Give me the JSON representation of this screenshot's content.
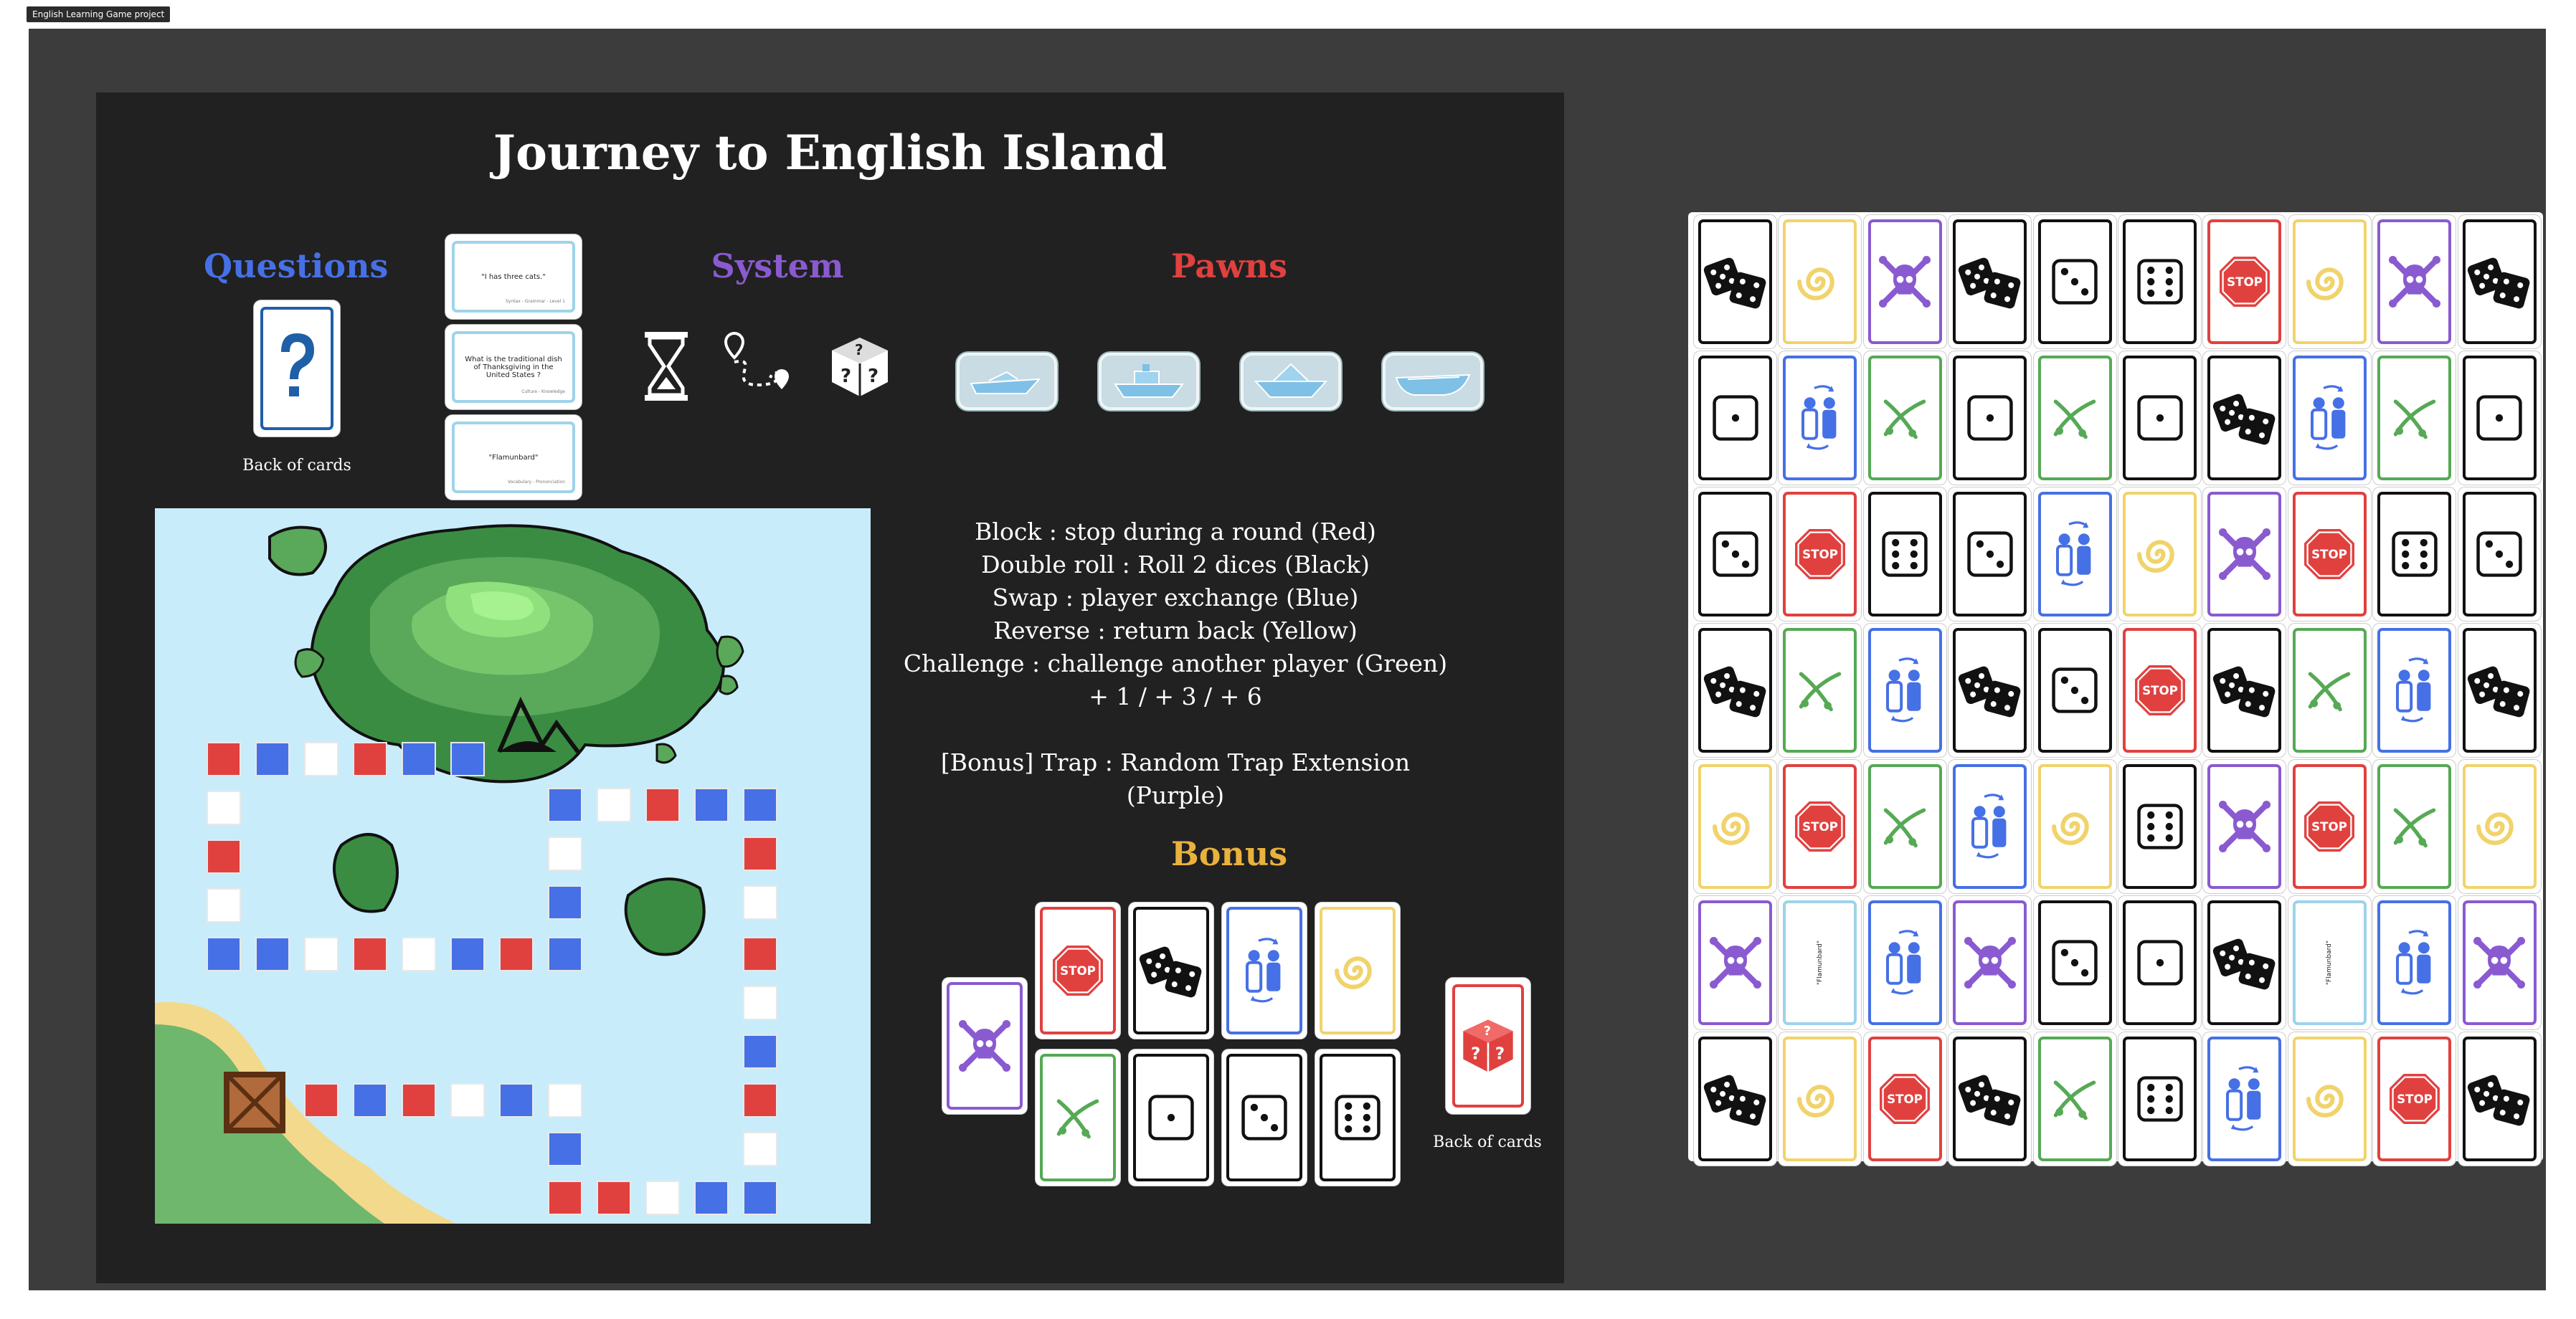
{
  "tab_label": "English Learning Game project",
  "board": {
    "title": "Journey to English Island",
    "questions_heading": "Questions",
    "system_heading": "System",
    "pawns_heading": "Pawns",
    "bonus_heading": "Bonus",
    "back_of_cards_label": "Back of cards",
    "back_of_cards_label_2": "Back of cards",
    "question_cards": [
      {
        "text": "\"I has three cats.\"",
        "foot": "Syntax - Grammar - Level 1"
      },
      {
        "text": "What is the traditional dish of Thanksgiving in the United States ?",
        "foot": "Culture - Knowledge"
      },
      {
        "text": "\"Flamunbard\"",
        "foot": "Vocabulary - Prononciation"
      }
    ],
    "rules": [
      "Block : stop during a round (Red)",
      "Double roll : Roll 2 dices (Black)",
      "Swap : player exchange (Blue)",
      "Reverse : return back (Yellow)",
      "Challenge : challenge another player (Green)",
      "+ 1 / + 3 / + 6",
      "",
      "[Bonus] Trap : Random Trap Extension (Purple)"
    ]
  },
  "colors": {
    "red": "#e0413f",
    "blue": "#4670e5",
    "yellow": "#f1d36c",
    "green": "#56a955",
    "purple": "#8a5ad0",
    "black": "#111111"
  },
  "grid_cards": [
    [
      "black-dice2",
      "yellow-swirl",
      "purple-skull",
      "black-dice2",
      "black-three",
      "black-six",
      "red-stop",
      "yellow-swirl",
      "purple-skull",
      "black-dice2"
    ],
    [
      "black-one",
      "blue-swap",
      "green-swords",
      "black-one",
      "green-swords",
      "black-one",
      "black-dice2",
      "blue-swap",
      "green-swords",
      "black-one"
    ],
    [
      "black-three",
      "red-stop",
      "black-six",
      "black-three",
      "blue-swap",
      "yellow-swirl",
      "purple-skull",
      "red-stop",
      "black-six",
      "black-three"
    ],
    [
      "black-dice2",
      "green-swords",
      "blue-swap",
      "black-dice2",
      "black-three",
      "red-stop",
      "black-dice2",
      "green-swords",
      "blue-swap",
      "black-dice2"
    ],
    [
      "yellow-swirl",
      "red-stop",
      "green-swords",
      "blue-swap",
      "yellow-swirl",
      "black-six",
      "purple-skull",
      "red-stop",
      "green-swords",
      "yellow-swirl"
    ],
    [
      "purple-skull",
      "plain-flam",
      "blue-swap",
      "purple-skull",
      "black-three",
      "black-one",
      "black-dice2",
      "plain-flam",
      "blue-swap",
      "purple-skull"
    ],
    [
      "black-dice2",
      "yellow-swirl",
      "red-stop",
      "black-dice2",
      "green-swords",
      "black-six",
      "blue-swap",
      "yellow-swirl",
      "red-stop",
      "black-dice2"
    ]
  ],
  "flam_text": "\"Flamunbard\"",
  "stop_text": "STOP"
}
